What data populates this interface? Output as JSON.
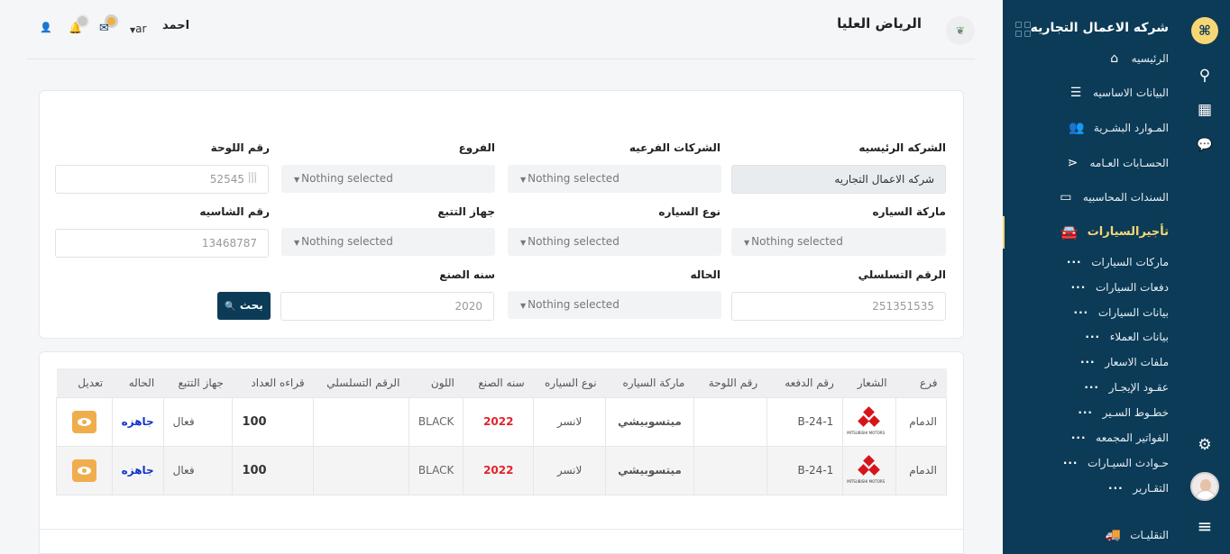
{
  "company": {
    "name": "شركه الاعمال التجاريه",
    "logo_glyph": "⌘"
  },
  "sidebar": {
    "items": [
      {
        "label": "الرئيسيه",
        "icon": "home-icon",
        "glyph": "⌂"
      },
      {
        "label": "البيانات الاساسيه",
        "icon": "server-icon",
        "glyph": "☰"
      },
      {
        "label": "المـوارد البشـرية",
        "icon": "users-icon",
        "glyph": "👥"
      },
      {
        "label": "الحسـابات العـامه",
        "icon": "share-icon",
        "glyph": "⋖"
      },
      {
        "label": "السندات المحاسبيه",
        "icon": "credit-card-icon",
        "glyph": "▭"
      },
      {
        "label": "تأجيرالسيارات",
        "icon": "car-icon",
        "glyph": "🚘"
      }
    ],
    "sub_items": [
      "ماركات السيارات",
      "دفعات السيارات",
      "بيانات السيارات",
      "بيانات العملاء",
      "ملفات الاسعار",
      "عقـود الإيجـار",
      "خطـوط السـير",
      "الفواتير المجمعه",
      "حـوادث السيـارات",
      "التقـارير"
    ],
    "bottom_item": {
      "label": "النقليـات",
      "icon": "truck-icon",
      "glyph": "🚚"
    }
  },
  "rail": {
    "icons": [
      {
        "name": "search-icon",
        "glyph": "⚲"
      },
      {
        "name": "calendar-icon",
        "glyph": "▦"
      },
      {
        "name": "chat-icon",
        "glyph": "💬"
      },
      {
        "name": "gear-icon",
        "glyph": "⚙"
      },
      {
        "name": "menu-icon",
        "glyph": "≡"
      }
    ]
  },
  "header": {
    "title": "الرياض العليا",
    "user_name": "احمد",
    "language": "ar",
    "leaf_glyph": "❦",
    "user_glyph": "👤",
    "mail_glyph": "✉",
    "bell_glyph": "🔔"
  },
  "filters": {
    "main_company": {
      "label": "الشركه الرئيسيه",
      "value": "شركه الاعمال التجاريه"
    },
    "sub_companies": {
      "label": "الشركات الفرعيه",
      "value": "Nothing selected"
    },
    "branches": {
      "label": "الفروع",
      "value": "Nothing selected"
    },
    "plate_number": {
      "label": "رقم اللوحة",
      "value": "52545",
      "suffix": "أأأ"
    },
    "car_brand": {
      "label": "ماركة السياره",
      "value": "Nothing selected"
    },
    "car_type": {
      "label": "نوع السياره",
      "value": "Nothing selected"
    },
    "tracker": {
      "label": "جهاز التتبع",
      "value": "Nothing selected"
    },
    "chassis_number": {
      "label": "رقم الشاسيه",
      "value": "13468787"
    },
    "serial_number": {
      "label": "الرقم التسلسلي",
      "value": "251351535"
    },
    "status": {
      "label": "الحاله",
      "value": "Nothing selected"
    },
    "manufacture_year": {
      "label": "سنه الصنع",
      "value": "2020"
    },
    "search_button": "بحث",
    "search_glyph": "🔍",
    "caret_glyph": "▼"
  },
  "table": {
    "headers": [
      "فرع",
      "الشعار",
      "رقم الدفعه",
      "رقم اللوحة",
      "ماركة السياره",
      "نوع السياره",
      "سنه الصنع",
      "اللون",
      "الرقم التسلسلي",
      "قراءه العداد",
      "جهاز التتبع",
      "الحاله",
      "تعديل"
    ],
    "rows": [
      {
        "branch": "الدمام",
        "logo_text": "MITSUBISHI MOTORS",
        "batch": "B-24-1",
        "plate": "",
        "brand": "ميتسوبيشي",
        "type": "لانسر",
        "year": "2022",
        "color": "BLACK",
        "serial": "",
        "meter": "100",
        "tracker": "فعال",
        "status": "جاهزه"
      },
      {
        "branch": "الدمام",
        "logo_text": "MITSUBISHI MOTORS",
        "batch": "B-24-1",
        "plate": "",
        "brand": "ميتسوبيشي",
        "type": "لانسر",
        "year": "2022",
        "color": "BLACK",
        "serial": "",
        "meter": "100",
        "tracker": "فعال",
        "status": "جاهزه"
      }
    ]
  },
  "colors": {
    "sidebar_bg": "#0c3b57",
    "accent": "#f7d775",
    "year_red": "#e0252b",
    "status_blue": "#1535c8",
    "view_button": "#f0ad4e"
  }
}
